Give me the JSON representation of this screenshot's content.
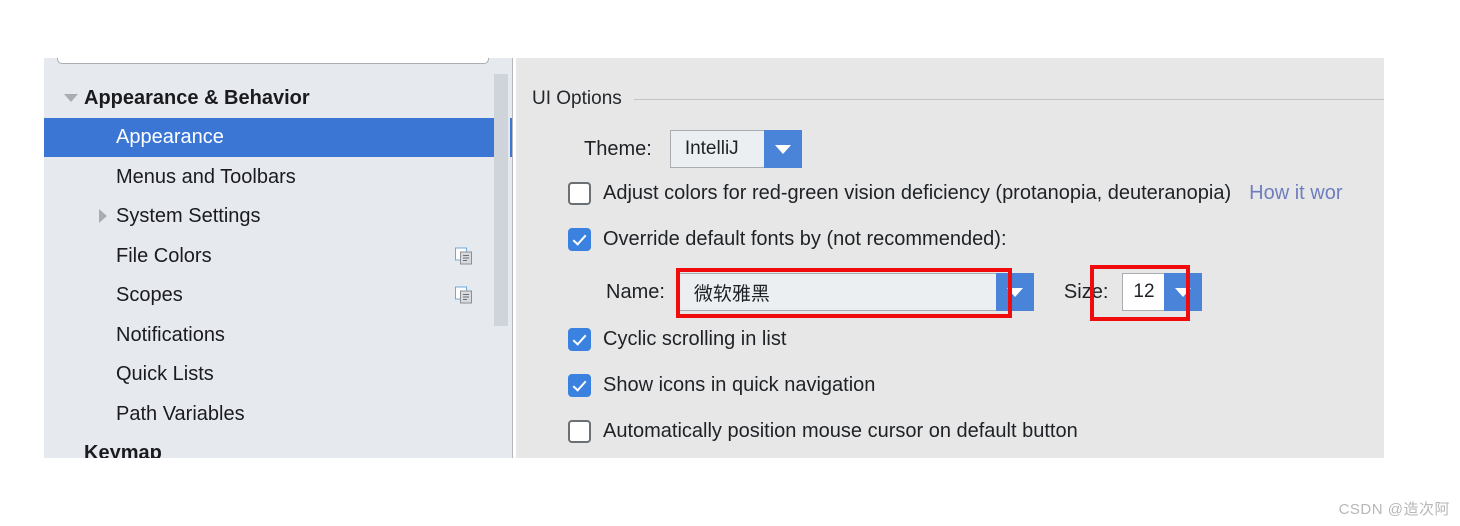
{
  "sidebar": {
    "search_placeholder": "",
    "items": [
      {
        "label": "Appearance & Behavior",
        "indent": 0,
        "twisty": "down",
        "selected": false,
        "group": true,
        "copy_icon": false
      },
      {
        "label": "Appearance",
        "indent": 1,
        "twisty": "none",
        "selected": true,
        "group": false,
        "copy_icon": false
      },
      {
        "label": "Menus and Toolbars",
        "indent": 1,
        "twisty": "none",
        "selected": false,
        "group": false,
        "copy_icon": false
      },
      {
        "label": "System Settings",
        "indent": 1,
        "twisty": "right",
        "selected": false,
        "group": false,
        "copy_icon": false
      },
      {
        "label": "File Colors",
        "indent": 1,
        "twisty": "none",
        "selected": false,
        "group": false,
        "copy_icon": true
      },
      {
        "label": "Scopes",
        "indent": 1,
        "twisty": "none",
        "selected": false,
        "group": false,
        "copy_icon": true
      },
      {
        "label": "Notifications",
        "indent": 1,
        "twisty": "none",
        "selected": false,
        "group": false,
        "copy_icon": false
      },
      {
        "label": "Quick Lists",
        "indent": 1,
        "twisty": "none",
        "selected": false,
        "group": false,
        "copy_icon": false
      },
      {
        "label": "Path Variables",
        "indent": 1,
        "twisty": "none",
        "selected": false,
        "group": false,
        "copy_icon": false
      },
      {
        "label": "Keymap",
        "indent": 0,
        "twisty": "none",
        "selected": false,
        "group": true,
        "copy_icon": false
      }
    ]
  },
  "content": {
    "group_title": "UI Options",
    "theme": {
      "label": "Theme:",
      "value": "IntelliJ"
    },
    "adjust_colors": {
      "label": "Adjust colors for red-green vision deficiency (protanopia, deuteranopia)",
      "checked": false,
      "link": "How it wor"
    },
    "override_fonts": {
      "label": "Override default fonts by (not recommended):",
      "checked": true
    },
    "font_name": {
      "label": "Name:",
      "value": "微软雅黑"
    },
    "font_size": {
      "label": "Size:",
      "value": "12"
    },
    "cyclic_scrolling": {
      "label": "Cyclic scrolling in list",
      "checked": true
    },
    "show_icons": {
      "label": "Show icons in quick navigation",
      "checked": true
    },
    "auto_position_cursor": {
      "label": "Automatically position mouse cursor on default button",
      "checked": false
    }
  },
  "annotations": {
    "highlight_color": "#f00c0c"
  },
  "watermark": {
    "text": "CSDN @造次阿"
  }
}
